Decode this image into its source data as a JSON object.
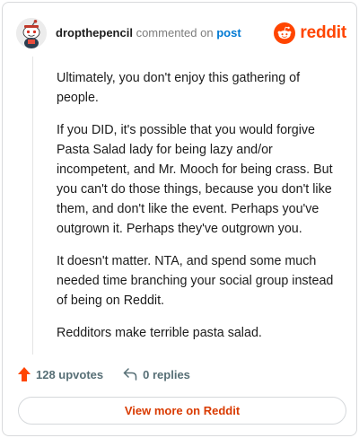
{
  "header": {
    "username": "dropthepencil",
    "action_text": "commented on",
    "post_link": "post",
    "brand_name": "reddit"
  },
  "comment": {
    "paragraphs": [
      "Ultimately, you don't enjoy this gathering of people.",
      "If you DID, it's possible that you would forgive Pasta Salad lady for being lazy and/or incompetent, and Mr. Mooch for being crass. But you can't do those things, because you don't like them, and don't like the event. Perhaps you've outgrown it. Perhaps they've outgrown you.",
      "It doesn't matter. NTA, and spend some much needed time branching your social group instead of being on Reddit.",
      "Redditors make terrible pasta salad."
    ]
  },
  "actions": {
    "upvotes": "128 upvotes",
    "replies": "0 replies"
  },
  "view_more_label": "View more on Reddit",
  "colors": {
    "brand": "#ff4500",
    "link": "#0079d3",
    "view_more_text": "#d93a00",
    "upvote_icon": "#ff4500"
  },
  "icons": {
    "upvote": "upvote-arrow-icon",
    "reply": "reply-arrow-icon",
    "brand": "reddit-snoo-icon"
  }
}
